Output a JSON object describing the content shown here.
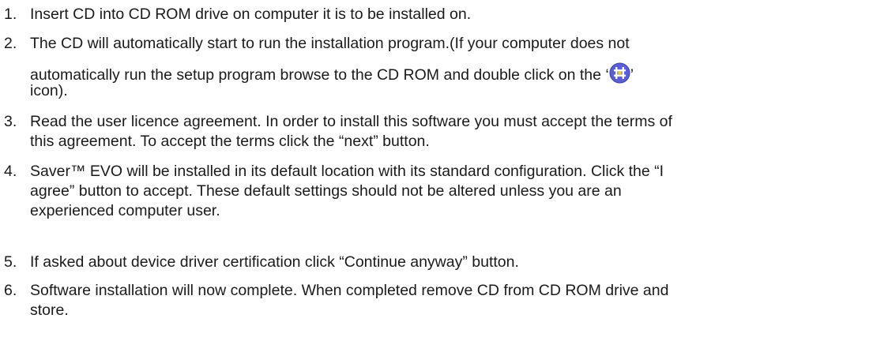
{
  "steps": [
    {
      "number": "1.",
      "lines": [
        "Insert CD into CD ROM drive on computer it is to be installed on."
      ]
    },
    {
      "number": "2.",
      "lines": [
        "The CD will automatically start to run the installation program.(If your computer does not",
        "automatically run the setup program browse to the CD ROM and double click on the ‘",
        "’",
        "icon)."
      ],
      "icon": "setup-program-icon"
    },
    {
      "number": "3.",
      "lines": [
        "Read the user licence agreement. In order to install this software you must accept the terms of",
        "this agreement. To accept the terms click the “next” button."
      ]
    },
    {
      "number": "4.",
      "lines": [
        "Saver™ EVO will be installed in its default location with its standard configuration. Click the “I",
        "agree” button to accept. These default settings should not be altered unless you are an",
        "experienced computer user."
      ]
    },
    {
      "number": "5.",
      "lines": [
        "If asked about device driver certification click “Continue anyway” button."
      ]
    },
    {
      "number": "6.",
      "lines": [
        "Software installation will now complete. When completed remove CD from CD ROM drive and",
        "store."
      ]
    }
  ],
  "colors": {
    "text": "#1a1a1a",
    "icon_fill": "#5b5fd6",
    "icon_mark": "#ffffff"
  }
}
